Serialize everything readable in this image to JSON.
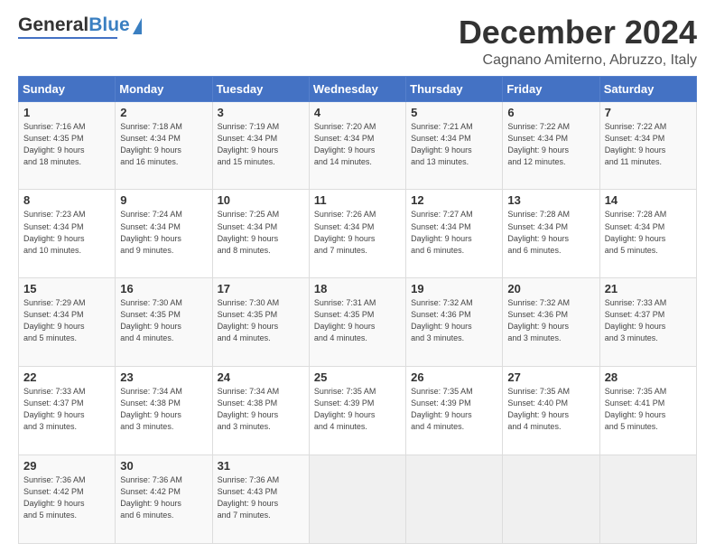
{
  "logo": {
    "general": "General",
    "blue": "Blue"
  },
  "title": "December 2024",
  "location": "Cagnano Amiterno, Abruzzo, Italy",
  "days_of_week": [
    "Sunday",
    "Monday",
    "Tuesday",
    "Wednesday",
    "Thursday",
    "Friday",
    "Saturday"
  ],
  "weeks": [
    [
      {
        "day": 1,
        "sunrise": "7:16 AM",
        "sunset": "4:35 PM",
        "daylight_hours": 9,
        "daylight_minutes": 18
      },
      {
        "day": 2,
        "sunrise": "7:18 AM",
        "sunset": "4:34 PM",
        "daylight_hours": 9,
        "daylight_minutes": 16
      },
      {
        "day": 3,
        "sunrise": "7:19 AM",
        "sunset": "4:34 PM",
        "daylight_hours": 9,
        "daylight_minutes": 15
      },
      {
        "day": 4,
        "sunrise": "7:20 AM",
        "sunset": "4:34 PM",
        "daylight_hours": 9,
        "daylight_minutes": 14
      },
      {
        "day": 5,
        "sunrise": "7:21 AM",
        "sunset": "4:34 PM",
        "daylight_hours": 9,
        "daylight_minutes": 13
      },
      {
        "day": 6,
        "sunrise": "7:22 AM",
        "sunset": "4:34 PM",
        "daylight_hours": 9,
        "daylight_minutes": 12
      },
      {
        "day": 7,
        "sunrise": "7:22 AM",
        "sunset": "4:34 PM",
        "daylight_hours": 9,
        "daylight_minutes": 11
      }
    ],
    [
      {
        "day": 8,
        "sunrise": "7:23 AM",
        "sunset": "4:34 PM",
        "daylight_hours": 9,
        "daylight_minutes": 10
      },
      {
        "day": 9,
        "sunrise": "7:24 AM",
        "sunset": "4:34 PM",
        "daylight_hours": 9,
        "daylight_minutes": 9
      },
      {
        "day": 10,
        "sunrise": "7:25 AM",
        "sunset": "4:34 PM",
        "daylight_hours": 9,
        "daylight_minutes": 8
      },
      {
        "day": 11,
        "sunrise": "7:26 AM",
        "sunset": "4:34 PM",
        "daylight_hours": 9,
        "daylight_minutes": 7
      },
      {
        "day": 12,
        "sunrise": "7:27 AM",
        "sunset": "4:34 PM",
        "daylight_hours": 9,
        "daylight_minutes": 6
      },
      {
        "day": 13,
        "sunrise": "7:28 AM",
        "sunset": "4:34 PM",
        "daylight_hours": 9,
        "daylight_minutes": 6
      },
      {
        "day": 14,
        "sunrise": "7:28 AM",
        "sunset": "4:34 PM",
        "daylight_hours": 9,
        "daylight_minutes": 5
      }
    ],
    [
      {
        "day": 15,
        "sunrise": "7:29 AM",
        "sunset": "4:34 PM",
        "daylight_hours": 9,
        "daylight_minutes": 5
      },
      {
        "day": 16,
        "sunrise": "7:30 AM",
        "sunset": "4:35 PM",
        "daylight_hours": 9,
        "daylight_minutes": 4
      },
      {
        "day": 17,
        "sunrise": "7:30 AM",
        "sunset": "4:35 PM",
        "daylight_hours": 9,
        "daylight_minutes": 4
      },
      {
        "day": 18,
        "sunrise": "7:31 AM",
        "sunset": "4:35 PM",
        "daylight_hours": 9,
        "daylight_minutes": 4
      },
      {
        "day": 19,
        "sunrise": "7:32 AM",
        "sunset": "4:36 PM",
        "daylight_hours": 9,
        "daylight_minutes": 3
      },
      {
        "day": 20,
        "sunrise": "7:32 AM",
        "sunset": "4:36 PM",
        "daylight_hours": 9,
        "daylight_minutes": 3
      },
      {
        "day": 21,
        "sunrise": "7:33 AM",
        "sunset": "4:37 PM",
        "daylight_hours": 9,
        "daylight_minutes": 3
      }
    ],
    [
      {
        "day": 22,
        "sunrise": "7:33 AM",
        "sunset": "4:37 PM",
        "daylight_hours": 9,
        "daylight_minutes": 3
      },
      {
        "day": 23,
        "sunrise": "7:34 AM",
        "sunset": "4:38 PM",
        "daylight_hours": 9,
        "daylight_minutes": 3
      },
      {
        "day": 24,
        "sunrise": "7:34 AM",
        "sunset": "4:38 PM",
        "daylight_hours": 9,
        "daylight_minutes": 3
      },
      {
        "day": 25,
        "sunrise": "7:35 AM",
        "sunset": "4:39 PM",
        "daylight_hours": 9,
        "daylight_minutes": 4
      },
      {
        "day": 26,
        "sunrise": "7:35 AM",
        "sunset": "4:39 PM",
        "daylight_hours": 9,
        "daylight_minutes": 4
      },
      {
        "day": 27,
        "sunrise": "7:35 AM",
        "sunset": "4:40 PM",
        "daylight_hours": 9,
        "daylight_minutes": 4
      },
      {
        "day": 28,
        "sunrise": "7:35 AM",
        "sunset": "4:41 PM",
        "daylight_hours": 9,
        "daylight_minutes": 5
      }
    ],
    [
      {
        "day": 29,
        "sunrise": "7:36 AM",
        "sunset": "4:42 PM",
        "daylight_hours": 9,
        "daylight_minutes": 5
      },
      {
        "day": 30,
        "sunrise": "7:36 AM",
        "sunset": "4:42 PM",
        "daylight_hours": 9,
        "daylight_minutes": 6
      },
      {
        "day": 31,
        "sunrise": "7:36 AM",
        "sunset": "4:43 PM",
        "daylight_hours": 9,
        "daylight_minutes": 7
      },
      null,
      null,
      null,
      null
    ]
  ]
}
